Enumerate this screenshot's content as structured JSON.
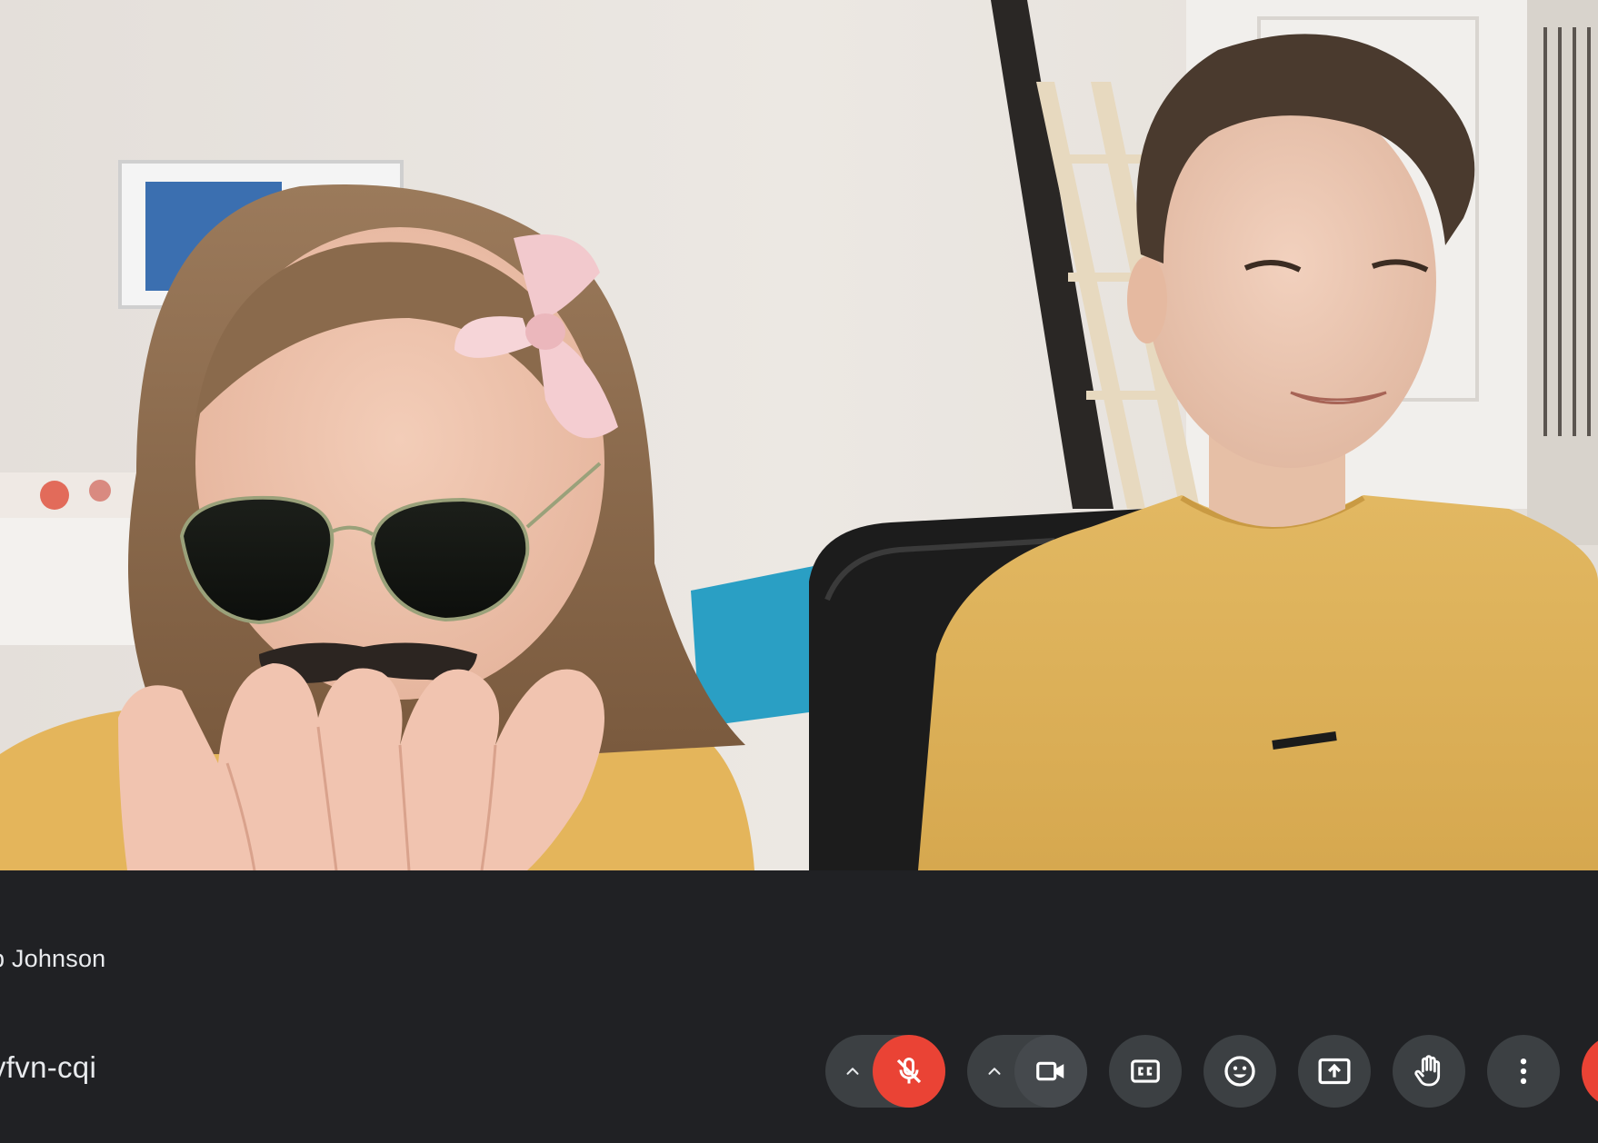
{
  "participant": {
    "name_label": "b Johnson"
  },
  "meeting": {
    "code": "yfvn-cqi"
  },
  "controls": {
    "mic": {
      "state": "muted",
      "icon": "mic-off-icon",
      "color": "#ea4335"
    },
    "camera": {
      "state": "on",
      "icon": "videocam-icon"
    },
    "captions": {
      "icon": "closed-caption-icon"
    },
    "reactions": {
      "icon": "emoji-icon"
    },
    "present": {
      "icon": "present-screen-icon"
    },
    "raise_hand": {
      "icon": "hand-icon"
    },
    "more": {
      "icon": "more-vert-icon"
    },
    "leave": {
      "icon": "call-end-icon",
      "color": "#ea4335"
    }
  },
  "theme": {
    "bar_background": "#202124",
    "button_background": "#3c4043",
    "danger": "#ea4335",
    "text": "#e8eaed"
  }
}
